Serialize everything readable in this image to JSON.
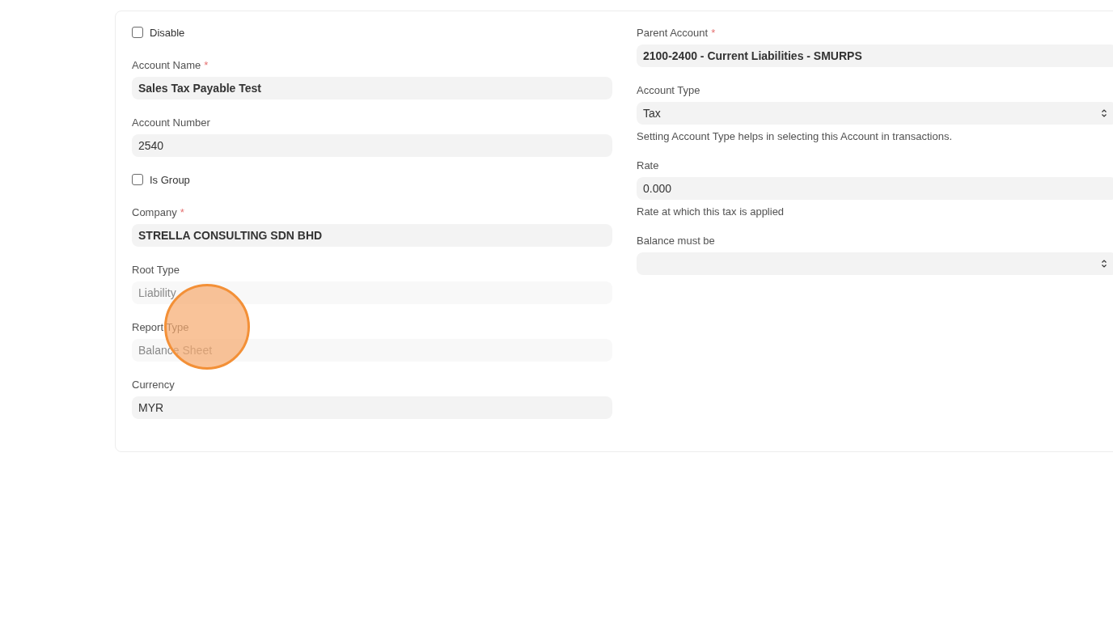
{
  "left_column": [
    {
      "kind": "checkbox",
      "label": "Disable",
      "checked": false
    },
    {
      "kind": "link",
      "label": "Account Name",
      "required_mark": "*",
      "value": "Sales Tax Payable Test"
    },
    {
      "kind": "data",
      "label": "Account Number",
      "value": "2540"
    },
    {
      "kind": "checkbox",
      "label": "Is Group",
      "checked": false
    },
    {
      "kind": "link",
      "label": "Company",
      "required_mark": "*",
      "value": "STRELLA CONSULTING SDN BHD"
    },
    {
      "kind": "readonly",
      "label": "Root Type",
      "value": "Liability"
    },
    {
      "kind": "readonly",
      "label": "Report Type",
      "value": "Balance Sheet"
    },
    {
      "kind": "data",
      "label": "Currency",
      "value": "MYR"
    }
  ],
  "right_column": [
    {
      "kind": "link",
      "label": "Parent Account",
      "required_mark": "*",
      "value": "2100-2400 - Current Liabilities - SMURPS"
    },
    {
      "kind": "select",
      "label": "Account Type",
      "value": "Tax",
      "description": "Setting Account Type helps in selecting this Account in transactions."
    },
    {
      "kind": "data",
      "label": "Rate",
      "value": "0.000",
      "description": "Rate at which this tax is applied"
    },
    {
      "kind": "select",
      "label": "Balance must be"
    }
  ]
}
